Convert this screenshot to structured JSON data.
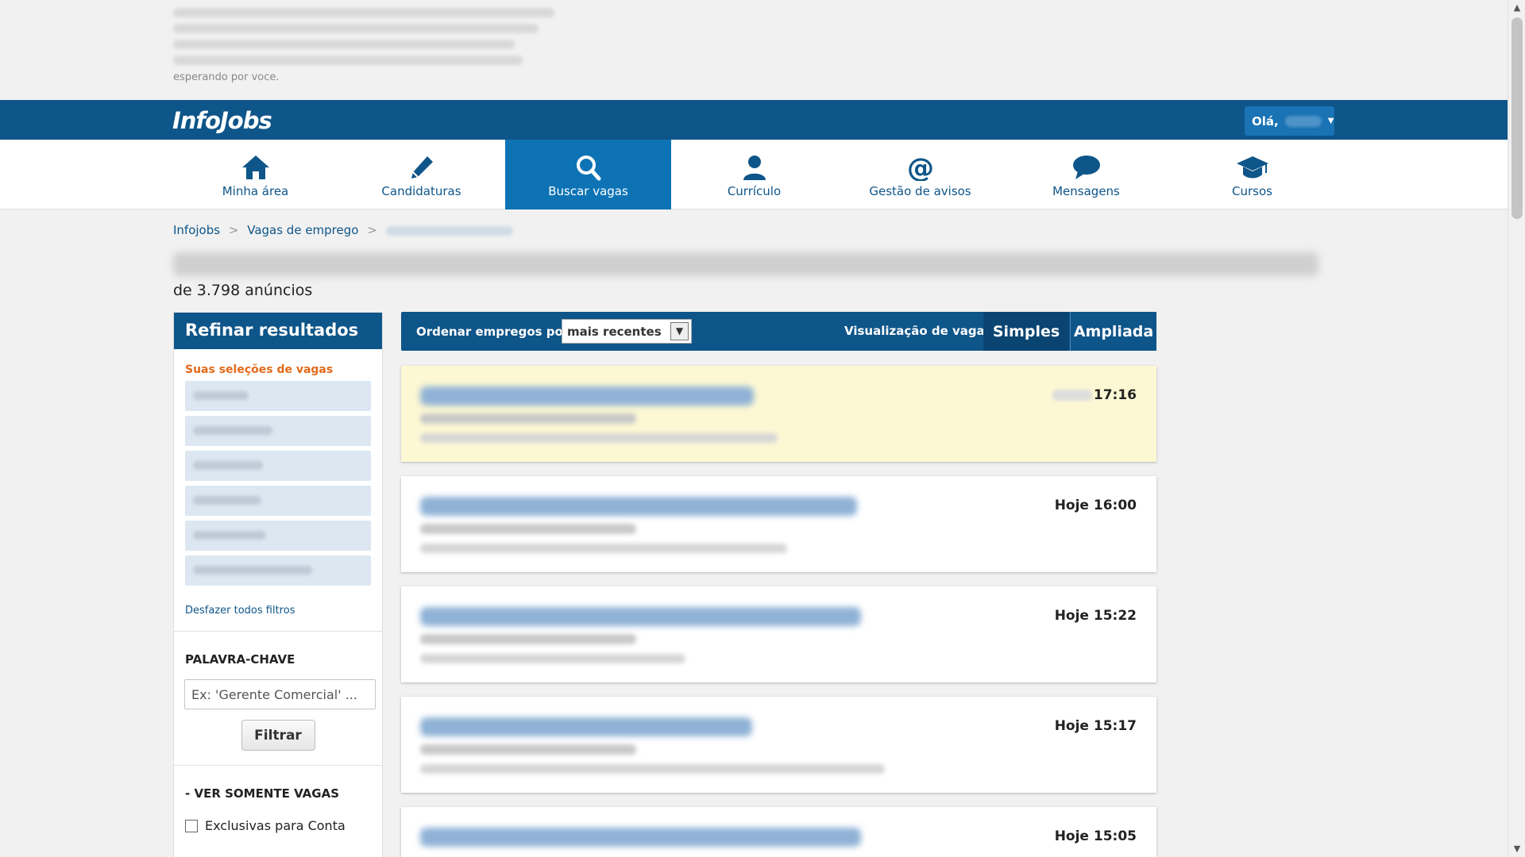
{
  "promo": {
    "text": "esperando por voce."
  },
  "header": {
    "logo": "InfoJobs",
    "greeting": "Olá,"
  },
  "nav": [
    {
      "label": "Minha área",
      "icon": "home-icon"
    },
    {
      "label": "Candidaturas",
      "icon": "pencil-icon"
    },
    {
      "label": "Buscar vagas",
      "icon": "search-icon",
      "active": true
    },
    {
      "label": "Currículo",
      "icon": "user-icon"
    },
    {
      "label": "Gestão de avisos",
      "icon": "at-icon"
    },
    {
      "label": "Mensagens",
      "icon": "chat-icon"
    },
    {
      "label": "Cursos",
      "icon": "graduation-cap-icon"
    }
  ],
  "breadcrumb": {
    "home": "Infojobs",
    "section": "Vagas de emprego",
    "sep": ">"
  },
  "results": {
    "count_text": "de 3.798 anúncios"
  },
  "sidebar": {
    "title": "Refinar resultados",
    "selections_title": "Suas seleções de vagas",
    "undo_filters": "Desfazer todos filtros",
    "keyword_title": "PALAVRA-CHAVE",
    "keyword_placeholder": "Ex: 'Gerente Comercial' ...",
    "filter_button": "Filtrar",
    "ver_somente_title": "VER SOMENTE VAGAS",
    "ver_somente_toggle": "-",
    "exclusive_option": "Exclusivas para Conta"
  },
  "sortbar": {
    "order_label": "Ordenar empregos por:",
    "order_value": "mais recentes",
    "view_label": "Visualização de vagas:",
    "view_simple": "Simples",
    "view_expanded": "Ampliada"
  },
  "jobs": [
    {
      "time": "17:16"
    },
    {
      "time": "Hoje 16:00"
    },
    {
      "time": "Hoje 15:22"
    },
    {
      "time": "Hoje 15:17"
    },
    {
      "time": "Hoje 15:05"
    }
  ],
  "colors": {
    "brand": "#0e5589",
    "active_nav": "#0e73b5",
    "accent_orange": "#e36a1a",
    "highlight_card": "#fdf8d4"
  }
}
